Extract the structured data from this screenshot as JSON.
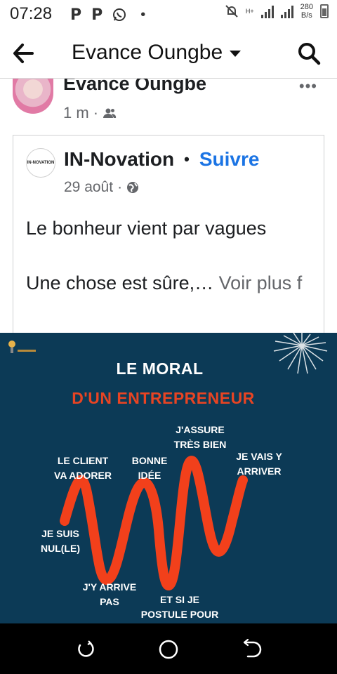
{
  "status_bar": {
    "time": "07:28",
    "left_icons": [
      "p-notification-icon",
      "p-notification-icon",
      "whatsapp-icon",
      "dot-icon"
    ],
    "net_type": "H+",
    "speed_value": "280",
    "speed_unit": "B/s"
  },
  "header": {
    "title": "Evance Oungbe"
  },
  "author": {
    "name": "Evance Oungbe",
    "time": "1 m",
    "audience_icon": "friends-icon",
    "more_label": "•••"
  },
  "shared_post": {
    "page_name": "IN-Novation",
    "page_logo_text": "IN-NOVATION",
    "separator": "•",
    "follow_label": "Suivre",
    "date": "29 août",
    "audience_icon": "globe-icon",
    "text_line1": "Le bonheur vient par vagues",
    "text_line2": "Une chose est sûre,…",
    "see_more": "Voir plus f"
  },
  "image": {
    "title": "LE MORAL",
    "subtitle": "D'UN ENTREPRENEUR",
    "labels": {
      "client": "LE CLIENT\nVA ADORER",
      "idee": "BONNE\nIDÉE",
      "assure": "J'ASSURE\nTRÈS BIEN",
      "vais": "JE VAIS Y\nARRIVER",
      "nul": "JE SUIS\nNUL(LE)",
      "arrive_pas": "J'Y ARRIVE\nPAS",
      "postule": "ET SI JE\nPOSTULE POUR"
    },
    "colors": {
      "background": "#0c3a56",
      "wave": "#f2401b",
      "accent_text": "#e84423"
    }
  },
  "nav_bar": {
    "buttons": [
      "recents-button",
      "home-button",
      "back-button"
    ]
  }
}
